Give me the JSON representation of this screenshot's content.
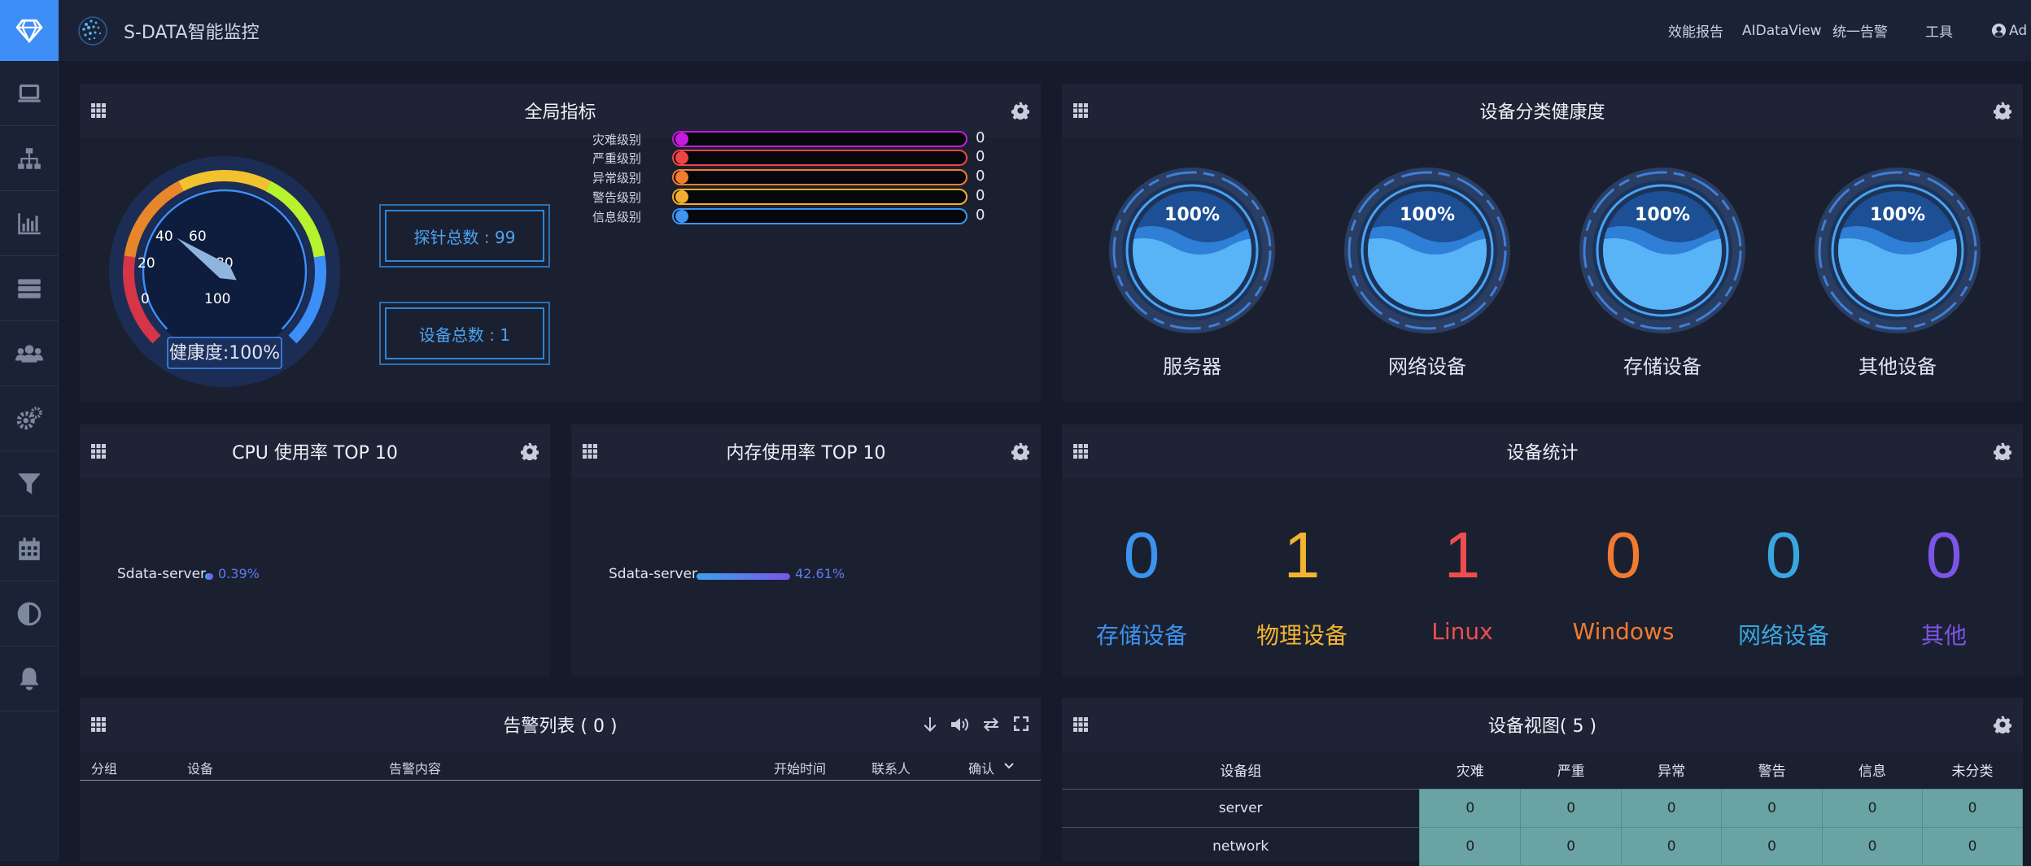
{
  "app": {
    "title": "S-DATA智能监控"
  },
  "topnav": [
    "效能报告",
    "AIDataView",
    "统一告警",
    "工具",
    "Ad"
  ],
  "sidebar": [
    "laptop-icon",
    "sitemap-icon",
    "bar-chart-icon",
    "server-icon",
    "users-icon",
    "cogs-icon",
    "filter-icon",
    "calendar-icon",
    "contrast-icon",
    "bell-icon"
  ],
  "global": {
    "title": "全局指标",
    "gauge": {
      "ticks": [
        "0",
        "20",
        "40",
        "60",
        "80",
        "100"
      ],
      "health_label": "健康度:100%",
      "value": 100
    },
    "probe_total": "探针总数 : 99",
    "device_total": "设备总数 : 1",
    "levels": [
      {
        "label": "灾难级别",
        "value": "0",
        "color": "#c61adf"
      },
      {
        "label": "严重级别",
        "value": "0",
        "color": "#ef4545"
      },
      {
        "label": "异常级别",
        "value": "0",
        "color": "#f07d2d"
      },
      {
        "label": "警告级别",
        "value": "0",
        "color": "#f2ae2c"
      },
      {
        "label": "信息级别",
        "value": "0",
        "color": "#3e94f0"
      }
    ]
  },
  "health": {
    "title": "设备分类健康度",
    "items": [
      {
        "label": "服务器",
        "pct": "100%"
      },
      {
        "label": "网络设备",
        "pct": "100%"
      },
      {
        "label": "存储设备",
        "pct": "100%"
      },
      {
        "label": "其他设备",
        "pct": "100%"
      }
    ]
  },
  "cpu": {
    "title": "CPU 使用率 TOP 10",
    "rows": [
      {
        "name": "Sdata-server",
        "value": 0.39,
        "text": "0.39%"
      }
    ]
  },
  "mem": {
    "title": "内存使用率 TOP 10",
    "rows": [
      {
        "name": "Sdata-server",
        "value": 42.61,
        "text": "42.61%"
      }
    ]
  },
  "stats": {
    "title": "设备统计",
    "items": [
      {
        "n": "0",
        "label": "存储设备",
        "color": "#3c93ee"
      },
      {
        "n": "1",
        "label": "物理设备",
        "color": "#f2b431"
      },
      {
        "n": "1",
        "label": "Linux",
        "color": "#ee4d4f"
      },
      {
        "n": "0",
        "label": "Windows",
        "color": "#f27a30"
      },
      {
        "n": "0",
        "label": "网络设备",
        "color": "#3aa6e0"
      },
      {
        "n": "0",
        "label": "其他",
        "color": "#7b55e8"
      }
    ]
  },
  "alarms": {
    "title": "告警列表 ( 0 )",
    "cols": [
      "分组",
      "设备",
      "告警内容",
      "开始时间",
      "联系人",
      "确认"
    ]
  },
  "devview": {
    "title": "设备视图( 5 )",
    "cols": [
      "设备组",
      "灾难",
      "严重",
      "异常",
      "警告",
      "信息",
      "未分类"
    ],
    "rows": [
      {
        "name": "server",
        "vals": [
          "0",
          "0",
          "0",
          "0",
          "0",
          "0"
        ]
      },
      {
        "name": "network",
        "vals": [
          "0",
          "0",
          "0",
          "0",
          "0",
          "0"
        ]
      }
    ]
  }
}
